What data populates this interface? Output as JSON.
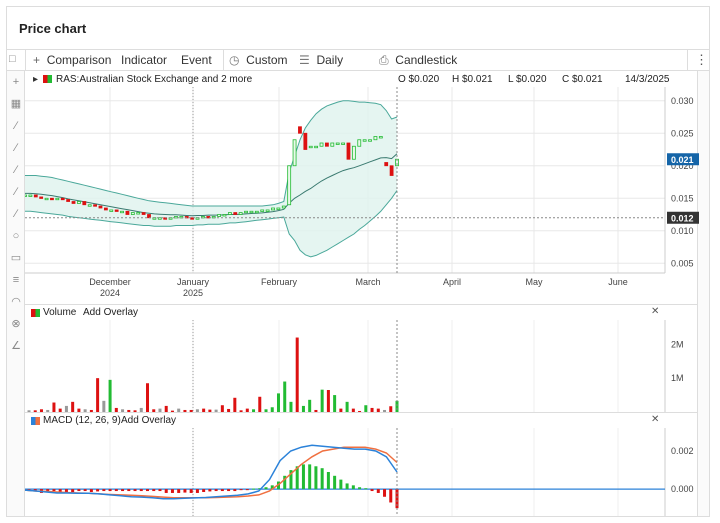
{
  "title": "Price chart",
  "toolbar": {
    "comparison": "Comparison",
    "indicator": "Indicator",
    "event": "Event",
    "custom": "Custom",
    "daily": "Daily",
    "candlestick": "Candlestick",
    "add_icon": "plus-icon",
    "clock_icon": "clock-icon",
    "interval_icon": "lines-icon",
    "candle_icon": "candlestick-icon",
    "more_icon": "kebab-icon"
  },
  "quote": {
    "symbol": "RAS:Australian Stock Exchange and 2 more",
    "open": "O $0.020",
    "high": "H $0.021",
    "low": "L $0.020",
    "close": "C $0.021",
    "date": "14/3/2025"
  },
  "colors": {
    "up": "#22bb33",
    "down": "#dd1111",
    "band": "#4aa89a",
    "price_tag": "#1565a8",
    "macd": "#2b82d9",
    "signal": "#f07040"
  },
  "chart_data": [
    {
      "type": "candlestick",
      "title": "",
      "x_labels": [
        {
          "label": "December",
          "sub": "2024"
        },
        {
          "label": "January",
          "sub": "2025"
        },
        {
          "label": "February",
          "sub": ""
        },
        {
          "label": "March",
          "sub": ""
        },
        {
          "label": "April",
          "sub": ""
        },
        {
          "label": "May",
          "sub": ""
        },
        {
          "label": "June",
          "sub": ""
        }
      ],
      "y_ticks": [
        "0.030",
        "0.025",
        "0.020",
        "0.015",
        "0.010",
        "0.005"
      ],
      "ylim": [
        0.0035,
        0.0315
      ],
      "last_price": "0.021",
      "crosshair_price": "0.012",
      "crosshair_date": "2025-03-14",
      "close": [
        0.0155,
        0.0155,
        0.0152,
        0.015,
        0.015,
        0.0148,
        0.015,
        0.0148,
        0.0145,
        0.0142,
        0.0145,
        0.014,
        0.014,
        0.0138,
        0.0135,
        0.0132,
        0.0132,
        0.013,
        0.013,
        0.0125,
        0.0128,
        0.0128,
        0.0125,
        0.012,
        0.012,
        0.012,
        0.0118,
        0.012,
        0.0122,
        0.0122,
        0.012,
        0.0118,
        0.012,
        0.0122,
        0.012,
        0.0122,
        0.0125,
        0.0125,
        0.0128,
        0.0125,
        0.0128,
        0.013,
        0.013,
        0.013,
        0.0132,
        0.0132,
        0.0135,
        0.0135,
        0.0138,
        0.02,
        0.024,
        0.025,
        0.0225,
        0.023,
        0.023,
        0.0235,
        0.023,
        0.0235,
        0.0235,
        0.0235,
        0.021,
        0.023,
        0.024,
        0.024,
        0.024,
        0.0245,
        0.0245,
        0.02,
        0.0185,
        0.021
      ],
      "open": [
        0.0155,
        0.0155,
        0.0155,
        0.0152,
        0.015,
        0.015,
        0.0148,
        0.015,
        0.0148,
        0.0145,
        0.0142,
        0.0145,
        0.014,
        0.014,
        0.0138,
        0.0135,
        0.0132,
        0.0132,
        0.013,
        0.013,
        0.0125,
        0.0128,
        0.0128,
        0.0125,
        0.012,
        0.012,
        0.012,
        0.0118,
        0.012,
        0.0122,
        0.0122,
        0.012,
        0.0118,
        0.012,
        0.0122,
        0.012,
        0.0122,
        0.0125,
        0.0125,
        0.0128,
        0.0125,
        0.0128,
        0.013,
        0.013,
        0.013,
        0.0132,
        0.0132,
        0.0135,
        0.0135,
        0.014,
        0.02,
        0.026,
        0.025,
        0.023,
        0.023,
        0.023,
        0.0235,
        0.023,
        0.0235,
        0.0235,
        0.0235,
        0.021,
        0.023,
        0.024,
        0.024,
        0.024,
        0.0245,
        0.0205,
        0.02,
        0.02
      ],
      "upper_band": [
        0.0185,
        0.0185,
        0.0185,
        0.0184,
        0.0183,
        0.0182,
        0.018,
        0.0178,
        0.0176,
        0.0174,
        0.0172,
        0.017,
        0.0168,
        0.0166,
        0.0164,
        0.0162,
        0.016,
        0.0158,
        0.0156,
        0.0154,
        0.0152,
        0.015,
        0.0148,
        0.0146,
        0.0145,
        0.0144,
        0.0143,
        0.0142,
        0.0141,
        0.014,
        0.0139,
        0.0138,
        0.0138,
        0.0138,
        0.0138,
        0.0138,
        0.0138,
        0.0138,
        0.0138,
        0.0138,
        0.0138,
        0.0138,
        0.0138,
        0.0138,
        0.0138,
        0.0139,
        0.014,
        0.0142,
        0.0145,
        0.019,
        0.0215,
        0.024,
        0.0258,
        0.027,
        0.028,
        0.0287,
        0.0292,
        0.0295,
        0.0298,
        0.03,
        0.03,
        0.0299,
        0.0298,
        0.0298,
        0.0297,
        0.0296,
        0.0294,
        0.0285,
        0.0272,
        0.0275
      ],
      "lower_band": [
        0.013,
        0.013,
        0.0129,
        0.0128,
        0.0127,
        0.0126,
        0.0125,
        0.0124,
        0.0122,
        0.0121,
        0.012,
        0.0119,
        0.0118,
        0.0117,
        0.0116,
        0.0115,
        0.0114,
        0.0113,
        0.0112,
        0.0111,
        0.011,
        0.0109,
        0.0108,
        0.0108,
        0.0107,
        0.0107,
        0.0107,
        0.0107,
        0.0108,
        0.0108,
        0.0108,
        0.0108,
        0.0109,
        0.0109,
        0.011,
        0.011,
        0.011,
        0.0111,
        0.0112,
        0.0112,
        0.0113,
        0.0114,
        0.0115,
        0.0116,
        0.0117,
        0.0118,
        0.0119,
        0.012,
        0.0121,
        0.0095,
        0.0085,
        0.007,
        0.0063,
        0.006,
        0.0062,
        0.0066,
        0.007,
        0.0075,
        0.008,
        0.0085,
        0.009,
        0.0095,
        0.0102,
        0.0108,
        0.0115,
        0.0122,
        0.013,
        0.014,
        0.015,
        0.0162
      ]
    },
    {
      "type": "bar",
      "title": "Volume",
      "overlay_label": "Add Overlay",
      "y_ticks": [
        "2M",
        "1M"
      ],
      "ylim": [
        0,
        2600000
      ],
      "values": [
        50000,
        50000,
        80000,
        60000,
        280000,
        100000,
        180000,
        300000,
        100000,
        80000,
        60000,
        1000000,
        330000,
        950000,
        120000,
        80000,
        60000,
        50000,
        120000,
        850000,
        80000,
        100000,
        180000,
        40000,
        100000,
        60000,
        60000,
        80000,
        100000,
        70000,
        70000,
        200000,
        90000,
        420000,
        50000,
        100000,
        80000,
        450000,
        80000,
        140000,
        550000,
        900000,
        300000,
        2200000,
        180000,
        360000,
        60000,
        660000,
        650000,
        500000,
        100000,
        300000,
        100000,
        30000,
        200000,
        120000,
        100000,
        60000,
        170000,
        330000
      ],
      "up": [
        false,
        false,
        false,
        false,
        false,
        false,
        false,
        false,
        false,
        false,
        false,
        false,
        false,
        true,
        false,
        false,
        false,
        false,
        false,
        false,
        false,
        false,
        false,
        false,
        false,
        false,
        false,
        false,
        false,
        false,
        false,
        false,
        false,
        false,
        false,
        false,
        true,
        false,
        true,
        true,
        true,
        true,
        true,
        false,
        true,
        true,
        false,
        true,
        false,
        true,
        false,
        true,
        false,
        false,
        true,
        false,
        false,
        false,
        false,
        true
      ]
    },
    {
      "type": "line",
      "title": "MACD (12, 26, 9)",
      "overlay_label": "Add Overlay",
      "y_ticks": [
        "0.002",
        "0.000"
      ],
      "ylim": [
        -0.0012,
        0.003
      ],
      "macd": [
        -5e-05,
        -0.0001,
        -0.00015,
        -0.0002,
        -0.0002,
        -0.00022,
        -0.00022,
        -0.00025,
        -0.0003,
        -0.00035,
        -0.0004,
        -0.00042,
        -0.00045,
        -0.0005,
        -0.0005,
        -0.00048,
        -0.00046,
        -0.00044,
        -0.0004,
        -0.00036,
        -0.00032,
        -0.00025,
        -0.0001,
        0.0005,
        0.0015,
        0.002,
        0.0022,
        0.0023,
        0.00225,
        0.0022,
        0.00215,
        0.0021,
        0.0021,
        0.002,
        0.0017,
        0.0009
      ],
      "signal": [
        -5e-05,
        -0.0001,
        -0.00012,
        -0.00015,
        -0.00018,
        -0.0002,
        -0.00022,
        -0.00025,
        -0.00028,
        -0.0003,
        -0.00032,
        -0.00035,
        -0.00038,
        -0.00042,
        -0.00045,
        -0.00045,
        -0.00045,
        -0.00045,
        -0.00044,
        -0.00042,
        -0.0004,
        -0.00036,
        -0.0003,
        -0.0001,
        0.0003,
        0.0008,
        0.0013,
        0.0017,
        0.002,
        0.0021,
        0.0022,
        0.0022,
        0.0022,
        0.0021,
        0.0019,
        0.0014
      ],
      "histogram": [
        -0.0001,
        -0.0001,
        -0.0002,
        -0.00015,
        -0.0001,
        -0.0002,
        -0.0002,
        -0.00015,
        -0.0001,
        -0.0001,
        -0.00015,
        -0.00012,
        -0.0001,
        -0.0001,
        -0.0001,
        -0.0001,
        -0.0001,
        -0.0001,
        -0.0001,
        -0.0001,
        -0.0001,
        -0.0001,
        -0.0002,
        -0.0002,
        -0.0002,
        -0.00018,
        -0.0002,
        -0.0002,
        -0.00015,
        -0.00012,
        -0.0001,
        -0.0001,
        -0.0001,
        -0.0001,
        -5e-05,
        -3e-05,
        3e-05,
        5e-05,
        0.0001,
        0.0002,
        0.0004,
        0.0007,
        0.001,
        0.0012,
        0.0013,
        0.0013,
        0.0012,
        0.0011,
        0.0009,
        0.0007,
        0.0005,
        0.0003,
        0.0002,
        0.0001,
        5e-05,
        -0.0001,
        -0.0002,
        -0.0004,
        -0.0007,
        -0.001
      ]
    }
  ]
}
